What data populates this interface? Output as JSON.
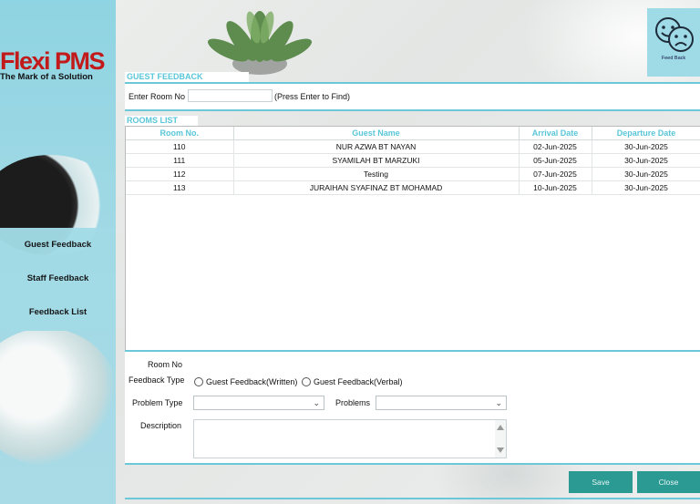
{
  "brand": {
    "name": "Flexi PMS",
    "tagline": "The Mark of a Solution"
  },
  "nav": {
    "items": [
      {
        "label": "Guest Feedback"
      },
      {
        "label": "Staff Feedback"
      },
      {
        "label": "Feedback List"
      }
    ]
  },
  "feedback_tile": {
    "label": "Feed Back",
    "icon": "happy-sad-faces-icon"
  },
  "guest_feedback": {
    "section_title": "GUEST FEEDBACK",
    "room_label": "Enter Room No",
    "room_value": "",
    "hint": "(Press Enter to Find)"
  },
  "rooms_list": {
    "section_title": "ROOMS LIST",
    "columns": [
      "Room No.",
      "Guest Name",
      "Arrival Date",
      "Departure Date"
    ],
    "rows": [
      [
        "110",
        "NUR AZWA BT NAYAN",
        "02-Jun-2025",
        "30-Jun-2025"
      ],
      [
        "111",
        "SYAMILAH BT MARZUKI",
        "05-Jun-2025",
        "30-Jun-2025"
      ],
      [
        "112",
        "Testing",
        "07-Jun-2025",
        "30-Jun-2025"
      ],
      [
        "113",
        "JURAIHAN SYAFINAZ BT MOHAMAD",
        "10-Jun-2025",
        "30-Jun-2025"
      ]
    ]
  },
  "form": {
    "room_no_label": "Room No",
    "room_no_value": "",
    "feedback_type_label": "Feedback Type",
    "feedback_type_options": [
      "Guest Feedback(Written)",
      "Guest Feedback(Verbal)"
    ],
    "problem_type_label": "Problem Type",
    "problem_type_value": "",
    "problems_label": "Problems",
    "problems_value": "",
    "description_label": "Description",
    "description_value": ""
  },
  "actions": {
    "save_label": "Save",
    "close_label": "Close"
  },
  "colors": {
    "accent": "#59c6d8",
    "panel": "#a2dbe6",
    "button": "#2a9a93",
    "brand_red": "#c21a1a"
  }
}
